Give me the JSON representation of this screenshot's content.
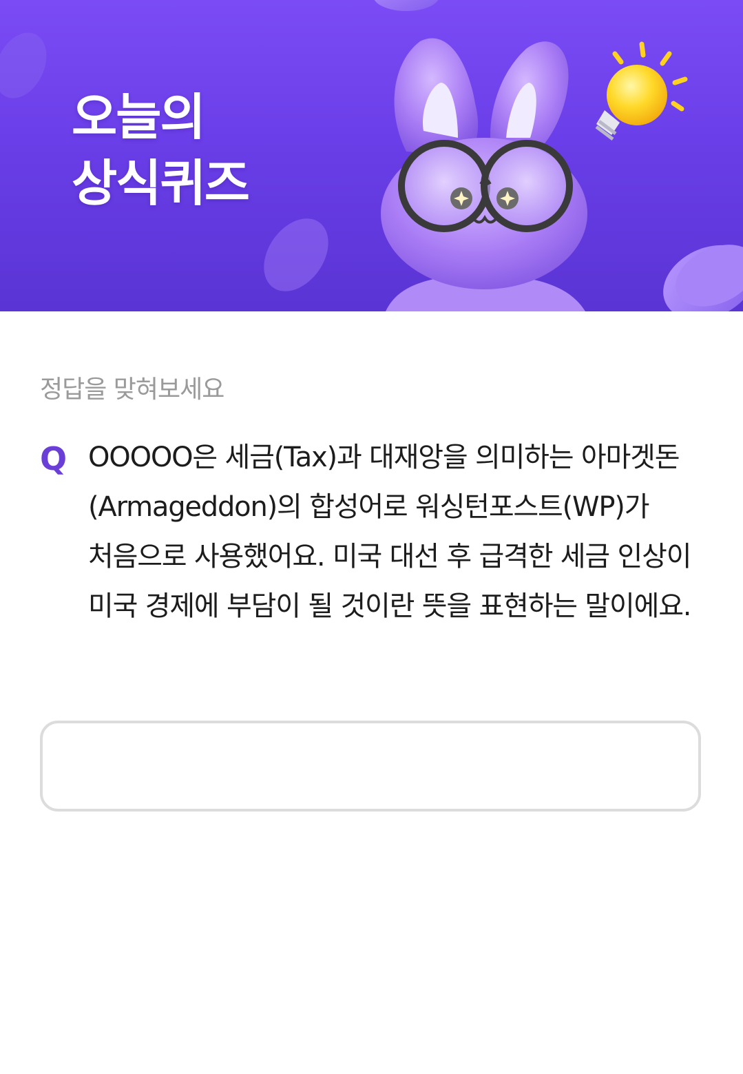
{
  "banner": {
    "title_line1": "오늘의",
    "title_line2": "상식퀴즈",
    "colors": {
      "background_top": "#7b4cf6",
      "background_bottom": "#5a34d4",
      "mascot": "#a97cf5",
      "bulb": "#ffd21f"
    },
    "icons": [
      "rabbit-mascot-icon",
      "lightbulb-icon",
      "coin-icon"
    ]
  },
  "quiz": {
    "prompt": "정답을 맞혀보세요",
    "q_label": "Q",
    "question": "OOOOO은 세금(Tax)과 대재앙을 의미하는 아마겟돈(Armageddon)의 합성어로 워싱턴포스트(WP)가 처음으로 사용했어요. 미국 대선 후 급격한 세금 인상이 미국 경제에 부담이 될 것이란 뜻을 표현하는 말이에요.",
    "answer_value": "",
    "answer_placeholder": "",
    "accent_color": "#6a3fd8"
  }
}
